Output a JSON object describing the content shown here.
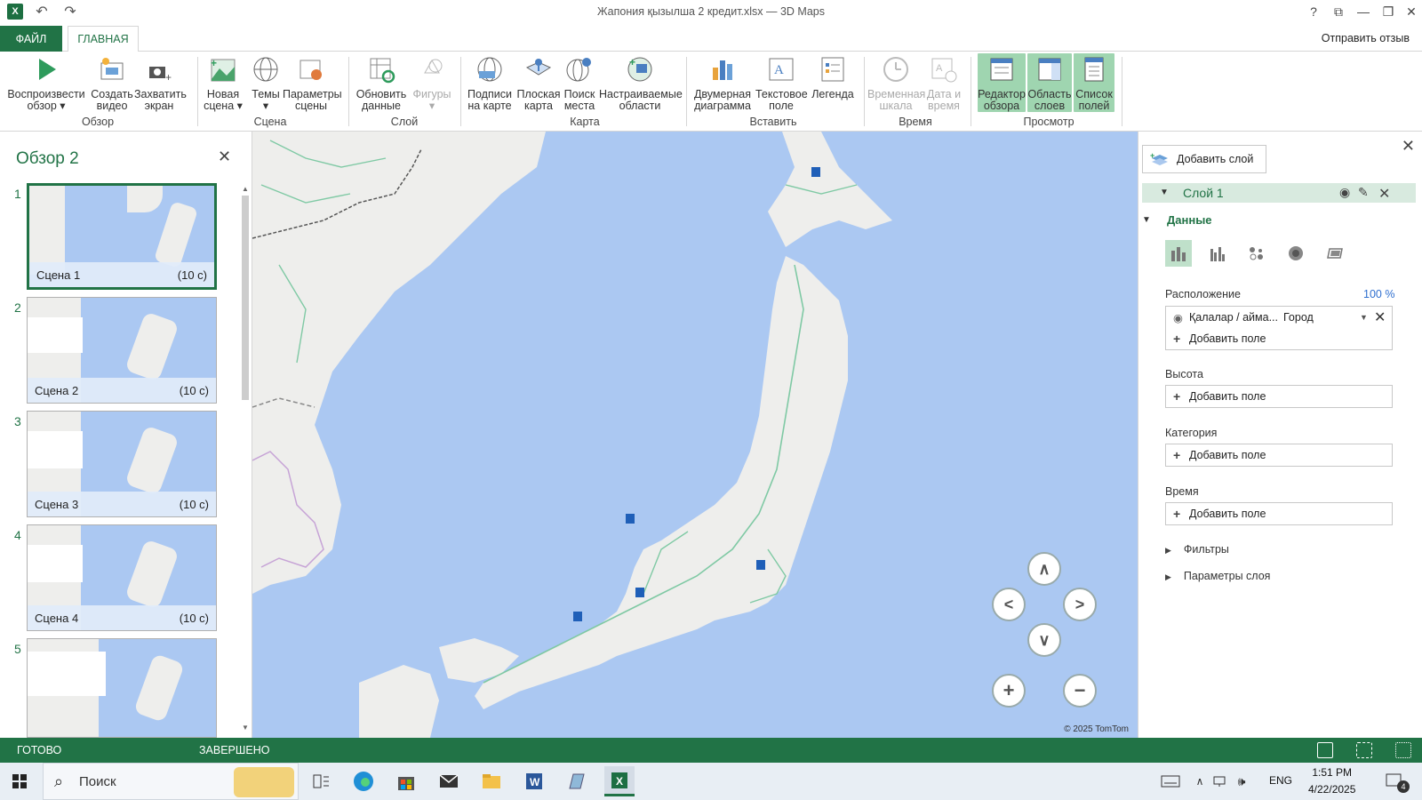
{
  "window": {
    "title": "Жапония қызылша 2 кредит.xlsx — 3D Maps",
    "help": "?",
    "logo_text": "X"
  },
  "tabs": {
    "file": "ФАЙЛ",
    "home": "ГЛАВНАЯ",
    "feedback": "Отправить отзыв"
  },
  "ribbon": {
    "buttons": {
      "play_tour": "Воспроизвести обзор ▾",
      "create_video": "Создать видео",
      "capture_screen": "Захватить экран",
      "new_scene": "Новая сцена ▾",
      "themes": "Темы ▾",
      "scene_options": "Параметры сцены",
      "refresh_data": "Обновить данные",
      "shapes": "Фигуры ▾",
      "map_labels": "Подписи на карте",
      "flat_map": "Плоская карта",
      "find_location": "Поиск места",
      "custom_regions": "Настраиваемые области",
      "chart_2d": "Двумерная диаграмма",
      "text_box": "Текстовое поле",
      "legend": "Легенда",
      "timeline": "Временная шкала",
      "date_time": "Дата и время",
      "tour_editor": "Редактор обзора",
      "layer_pane": "Область слоев",
      "field_list": "Список полей"
    },
    "groups": {
      "tour": "Обзор",
      "scene": "Сцена",
      "layer": "Слой",
      "map": "Карта",
      "insert": "Вставить",
      "time": "Время",
      "view": "Просмотр"
    }
  },
  "tour_pane": {
    "title": "Обзор 2",
    "close": "✕",
    "scenes": [
      {
        "num": "1",
        "name": "Сцена 1",
        "duration": "(10 с)"
      },
      {
        "num": "2",
        "name": "Сцена 2",
        "duration": "(10 с)"
      },
      {
        "num": "3",
        "name": "Сцена 3",
        "duration": "(10 с)"
      },
      {
        "num": "4",
        "name": "Сцена 4",
        "duration": "(10 с)"
      },
      {
        "num": "5",
        "name": "",
        "duration": ""
      }
    ]
  },
  "map": {
    "copyright": "© 2025 TomTom",
    "marker_color": "#1f5fb8"
  },
  "layer_pane": {
    "add_layer": "Добавить слой",
    "close": "✕",
    "layer_name": "Слой 1",
    "data_section": "Данные",
    "location_label": "Расположение",
    "location_percent": "100 %",
    "location_field": "Қалалар / айма...",
    "location_type": "Город",
    "add_field": "Добавить поле",
    "height_label": "Высота",
    "category_label": "Категория",
    "time_label": "Время",
    "filters": "Фильтры",
    "layer_options": "Параметры слоя"
  },
  "status": {
    "ready": "ГОТОВО",
    "done": "ЗАВЕРШЕНО"
  },
  "taskbar": {
    "search": "Поиск",
    "lang": "ENG",
    "time": "1:51 PM",
    "date": "4/22/2025",
    "notif_count": "4"
  },
  "colors": {
    "accent": "#217346",
    "map_water": "#abc8f2",
    "map_land": "#eeeeec",
    "roads": "#7fc9a4"
  }
}
